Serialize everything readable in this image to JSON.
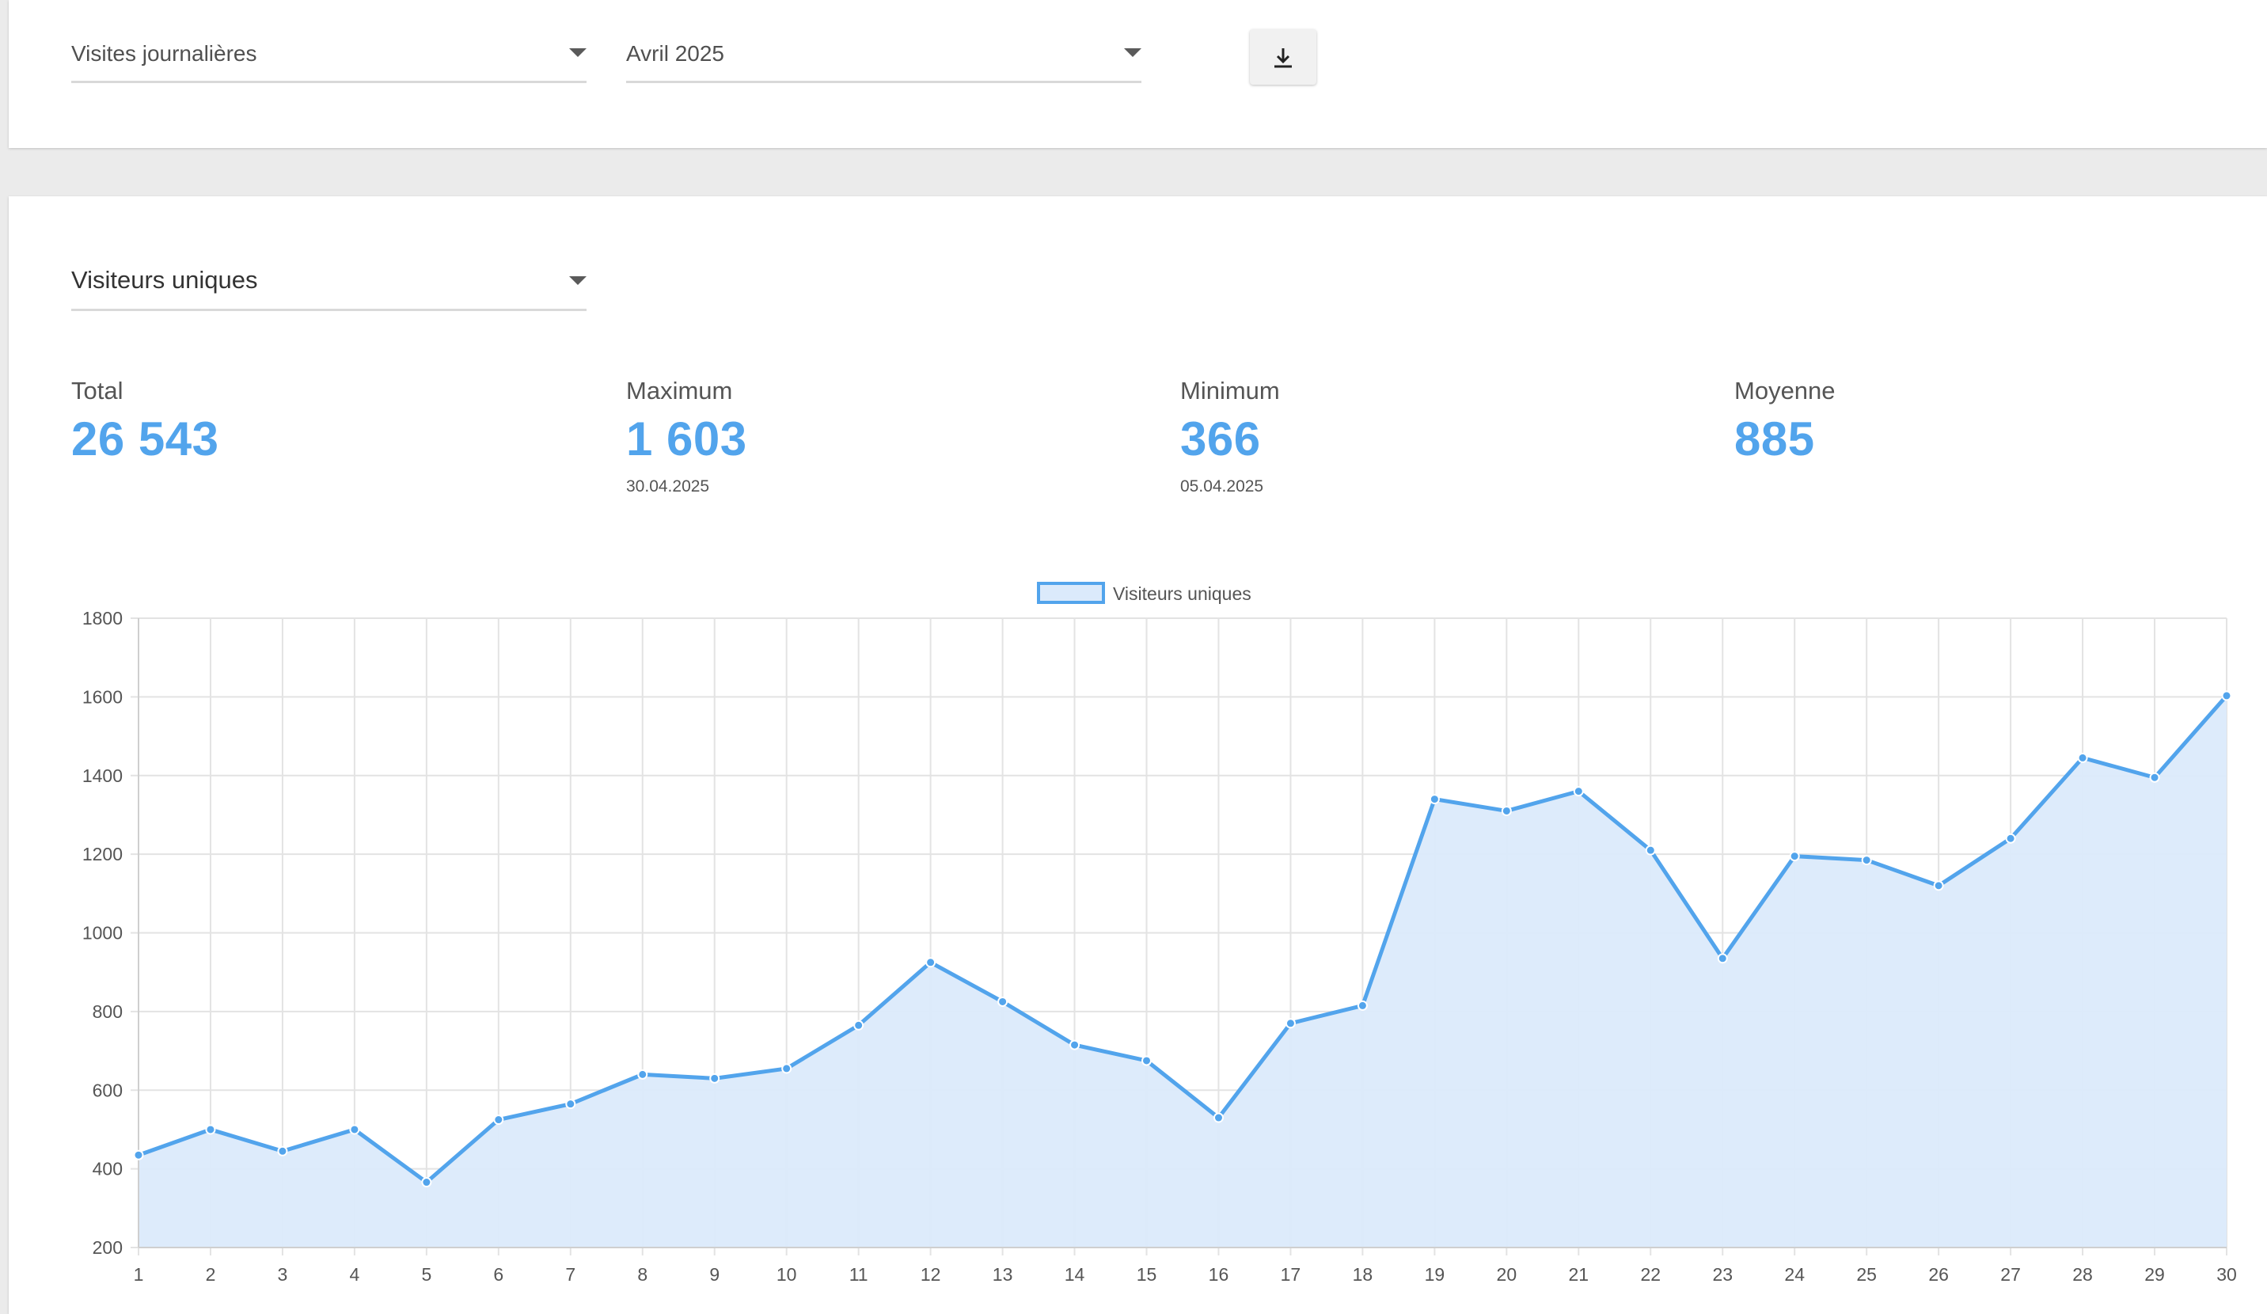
{
  "filters": {
    "visits_select": "Visites journalières",
    "period_select": "Avril 2025"
  },
  "toolbar": {
    "download_icon": "download-icon"
  },
  "metric_select": "Visiteurs uniques",
  "stats": {
    "total": {
      "label": "Total",
      "value": "26 543"
    },
    "maximum": {
      "label": "Maximum",
      "value": "1 603",
      "date": "30.04.2025"
    },
    "minimum": {
      "label": "Minimum",
      "value": "366",
      "date": "05.04.2025"
    },
    "average": {
      "label": "Moyenne",
      "value": "885"
    }
  },
  "colors": {
    "accent": "#52a4ec",
    "area_fill": "#dbeafb",
    "grid": "#e3e3e3"
  },
  "chart_data": {
    "type": "area",
    "x": [
      1,
      2,
      3,
      4,
      5,
      6,
      7,
      8,
      9,
      10,
      11,
      12,
      13,
      14,
      15,
      16,
      17,
      18,
      19,
      20,
      21,
      22,
      23,
      24,
      25,
      26,
      27,
      28,
      29,
      30
    ],
    "series": [
      {
        "name": "Visiteurs uniques",
        "values": [
          435,
          500,
          445,
          500,
          366,
          525,
          565,
          640,
          630,
          655,
          765,
          925,
          825,
          715,
          675,
          530,
          770,
          815,
          1340,
          1310,
          1360,
          1210,
          935,
          1195,
          1185,
          1120,
          1240,
          1445,
          1395,
          1603
        ]
      }
    ],
    "ylim": [
      200,
      1800
    ],
    "yticks": [
      200,
      400,
      600,
      800,
      1000,
      1200,
      1400,
      1600,
      1800
    ],
    "grid": true,
    "legend": "top-center"
  }
}
